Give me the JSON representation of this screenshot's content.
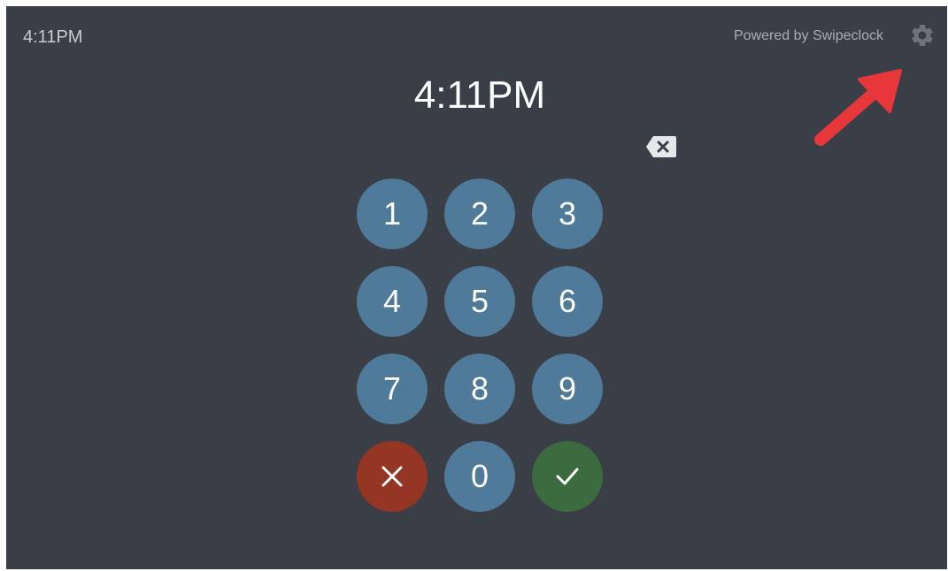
{
  "status_bar": {
    "time": "4:11PM",
    "powered_by": "Powered by Swipeclock"
  },
  "icons": {
    "settings": "gear-icon",
    "backspace": "backspace-icon",
    "cancel": "close-icon",
    "confirm": "check-icon"
  },
  "clock": {
    "time": "4:11PM"
  },
  "keypad": {
    "keys": [
      "1",
      "2",
      "3",
      "4",
      "5",
      "6",
      "7",
      "8",
      "9",
      "0"
    ]
  },
  "colors": {
    "background": "#3a3f47",
    "key": "#4f7a99",
    "cancel": "#953523",
    "confirm": "#3d6b40",
    "annotation_arrow": "#e8373a"
  }
}
